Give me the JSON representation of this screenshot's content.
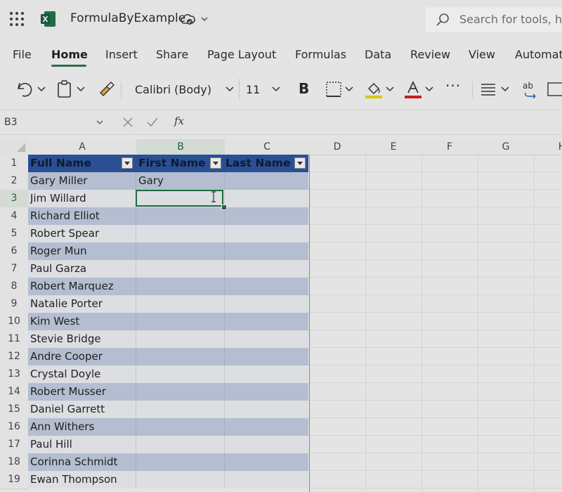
{
  "titlebar": {
    "doc_title": "FormulaByExample",
    "search_placeholder": "Search for tools, he"
  },
  "menu": {
    "tabs": [
      "File",
      "Home",
      "Insert",
      "Share",
      "Page Layout",
      "Formulas",
      "Data",
      "Review",
      "View",
      "Automat"
    ],
    "active": "Home"
  },
  "ribbon": {
    "font_name": "Calibri (Body)",
    "font_size": "11",
    "bold_label": "B",
    "more_label": "···"
  },
  "formula_bar": {
    "name_box": "B3",
    "fx_label": "fx"
  },
  "grid": {
    "columns": [
      "A",
      "B",
      "C",
      "D",
      "E",
      "F",
      "G",
      "H"
    ],
    "selected_column": "B",
    "selected_row": "3",
    "rows": [
      "1",
      "2",
      "3",
      "4",
      "5",
      "6",
      "7",
      "8",
      "9",
      "10",
      "11",
      "12",
      "13",
      "14",
      "15",
      "16",
      "17",
      "18",
      "19"
    ],
    "table_headers": [
      "Full Name",
      "First Name",
      "Last Name"
    ],
    "full_names": [
      "Gary Miller",
      "Jim Willard",
      "Richard Elliot",
      "Robert Spear",
      "Roger Mun",
      "Paul Garza",
      "Robert Marquez",
      "Natalie Porter",
      "Kim West",
      "Stevie Bridge",
      "Andre Cooper",
      "Crystal Doyle",
      "Robert Musser",
      "Daniel Garrett",
      "Ann Withers",
      "Paul Hill",
      "Corinna Schmidt",
      "Ewan Thompson"
    ],
    "first_names": [
      "Gary",
      "",
      "",
      "",
      "",
      "",
      "",
      "",
      "",
      "",
      "",
      "",
      "",
      "",
      "",
      "",
      "",
      ""
    ]
  },
  "colors": {
    "accent": "#2d6b4a",
    "table_header": "#2b4f93",
    "table_band": "#b4bed0"
  }
}
